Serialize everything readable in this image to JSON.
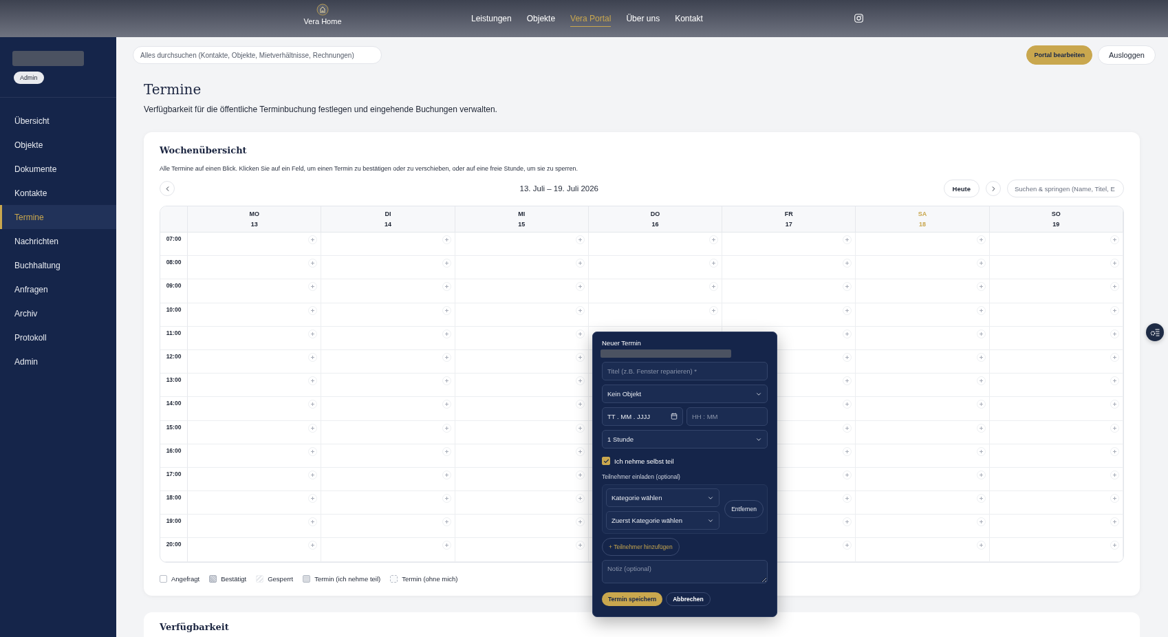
{
  "top_nav": {
    "brand": "Vera Home",
    "links": [
      {
        "label": "Leistungen",
        "selected": false
      },
      {
        "label": "Objekte",
        "selected": false
      },
      {
        "label": "Vera Portal",
        "selected": true
      },
      {
        "label": "Über uns",
        "selected": false
      },
      {
        "label": "Kontakt",
        "selected": false
      }
    ]
  },
  "sidebar": {
    "badge": "Admin",
    "items": [
      {
        "label": "Übersicht",
        "selected": false
      },
      {
        "label": "Objekte",
        "selected": false
      },
      {
        "label": "Dokumente",
        "selected": false
      },
      {
        "label": "Kontakte",
        "selected": false
      },
      {
        "label": "Termine",
        "selected": true
      },
      {
        "label": "Nachrichten",
        "selected": false
      },
      {
        "label": "Buchhaltung",
        "selected": false
      },
      {
        "label": "Anfragen",
        "selected": false
      },
      {
        "label": "Archiv",
        "selected": false
      },
      {
        "label": "Protokoll",
        "selected": false
      },
      {
        "label": "Admin",
        "selected": false
      }
    ]
  },
  "toolbar": {
    "search": {
      "placeholder": "Alles durchsuchen (Kontakte, Objekte, Mietverhältnisse, Rechnungen)"
    },
    "buttons": [
      {
        "label": "Portal bearbeiten",
        "kind": "primary"
      },
      {
        "label": "Ausloggen",
        "kind": "secondary"
      }
    ]
  },
  "page": {
    "title": "Termine",
    "subtitle": "Verfügbarkeit für die öffentliche Terminbuchung festlegen und eingehende Buchungen verwalten."
  },
  "week_card": {
    "title": "Wochenübersicht",
    "description": "Alle Termine auf einen Blick. Klicken Sie auf ein Feld, um einen Termin zu bestätigen oder zu verschieben, oder auf eine freie Stunde, um sie zu sperren.",
    "range": "13. Juli – 19. Juli 2026",
    "today_button": "Heute",
    "search": {
      "placeholder": "Suchen & springen (Name, Titel, E"
    },
    "days": [
      {
        "abbr": "MO",
        "date": "13",
        "highlighted": false
      },
      {
        "abbr": "DI",
        "date": "14",
        "highlighted": false
      },
      {
        "abbr": "MI",
        "date": "15",
        "highlighted": false
      },
      {
        "abbr": "DO",
        "date": "16",
        "highlighted": false
      },
      {
        "abbr": "FR",
        "date": "17",
        "highlighted": false
      },
      {
        "abbr": "SA",
        "date": "18",
        "highlighted": true
      },
      {
        "abbr": "SO",
        "date": "19",
        "highlighted": false
      }
    ],
    "times": [
      "07:00",
      "08:00",
      "09:00",
      "10:00",
      "11:00",
      "12:00",
      "13:00",
      "14:00",
      "15:00",
      "16:00",
      "17:00",
      "18:00",
      "19:00",
      "20:00"
    ],
    "legend": [
      {
        "label": "Angefragt",
        "kind": "requested"
      },
      {
        "label": "Bestätigt",
        "kind": "confirmed"
      },
      {
        "label": "Gesperrt",
        "kind": "blocked"
      },
      {
        "label": "Termin (ich nehme teil)",
        "kind": "mine"
      },
      {
        "label": "Termin (ohne mich)",
        "kind": "others"
      }
    ]
  },
  "next_card": {
    "title": "Verfügbarkeit"
  },
  "popup": {
    "title": "Neuer Termin",
    "title_field": {
      "placeholder": "Titel (z.B. Fenster reparieren) *"
    },
    "object_select": "Kein Objekt",
    "date_field": {
      "placeholder": "TT . MM . JJJJ"
    },
    "time_field": {
      "placeholder": "HH : MM"
    },
    "duration_select": "1 Stunde",
    "self_checkbox": {
      "label": "Ich nehme selbst teil",
      "checked": true
    },
    "invite_label": "Teilnehmer einladen (optional)",
    "category_select": "Kategorie wählen",
    "person_select": "Zuerst Kategorie wählen",
    "remove_button": "Entfernen",
    "add_button": "+ Teilnehmer hinzufügen",
    "note_field": {
      "placeholder": "Notiz (optional)"
    },
    "save_button": "Termin speichern",
    "cancel_button": "Abbrechen"
  }
}
